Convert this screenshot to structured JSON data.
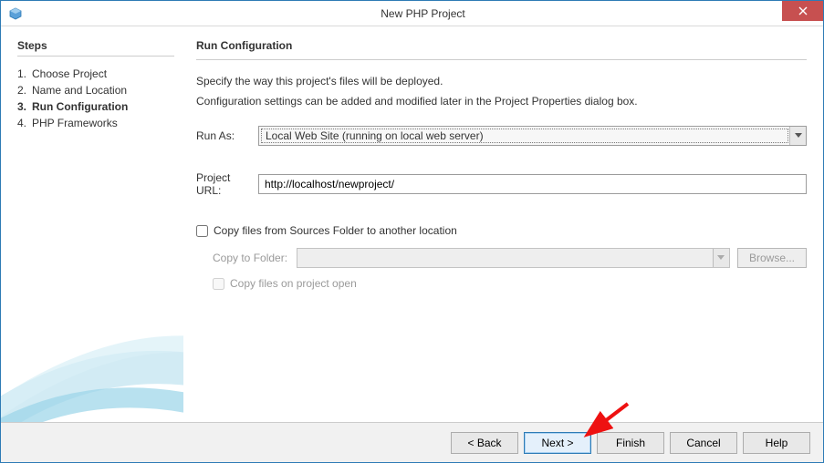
{
  "window": {
    "title": "New PHP Project"
  },
  "sidebar": {
    "heading": "Steps",
    "items": [
      {
        "num": "1.",
        "label": "Choose Project"
      },
      {
        "num": "2.",
        "label": "Name and Location"
      },
      {
        "num": "3.",
        "label": "Run Configuration"
      },
      {
        "num": "4.",
        "label": "PHP Frameworks"
      }
    ],
    "active_index": 2
  },
  "main": {
    "heading": "Run Configuration",
    "desc1": "Specify the way this project's files will be deployed.",
    "desc2": "Configuration settings can be added and modified later in the Project Properties dialog box.",
    "run_as_label": "Run As:",
    "run_as_value": "Local Web Site (running on local web server)",
    "project_url_label": "Project URL:",
    "project_url_value": "http://localhost/newproject/",
    "copy_files_checkbox": "Copy files from Sources Folder to another location",
    "copy_to_folder_label": "Copy to Folder:",
    "copy_to_folder_value": "",
    "browse_button": "Browse...",
    "copy_on_open_checkbox": "Copy files on project open"
  },
  "footer": {
    "back": "< Back",
    "next": "Next >",
    "finish": "Finish",
    "cancel": "Cancel",
    "help": "Help"
  }
}
